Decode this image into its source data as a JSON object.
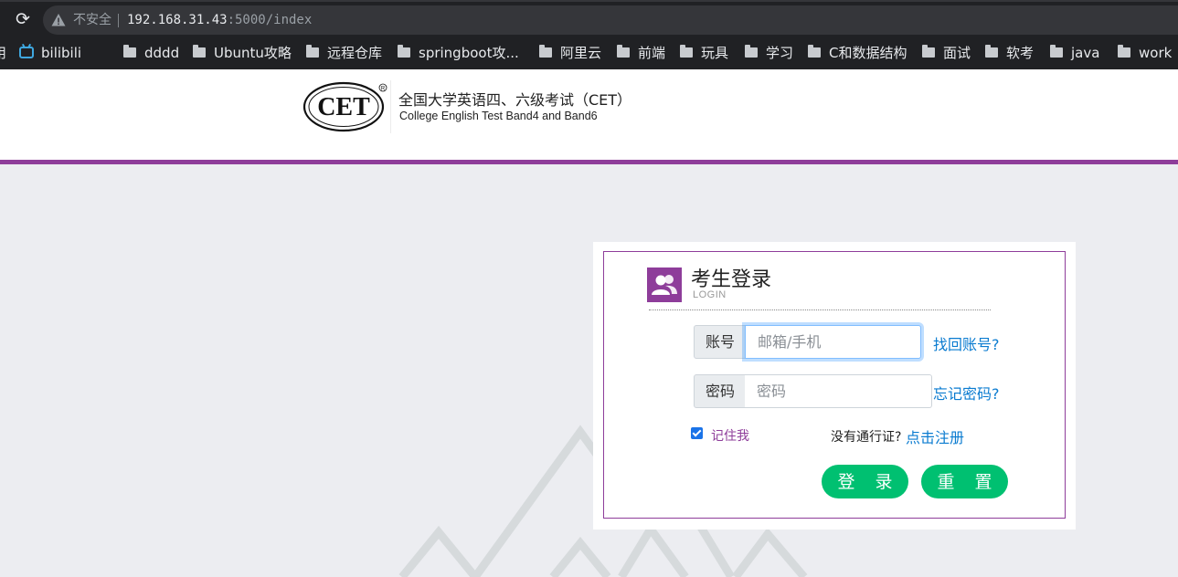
{
  "browser": {
    "security_label": "不安全",
    "url_host": "192.168.31.43",
    "url_rest": ":5000/index",
    "bookmarks": [
      {
        "label": "bilibili",
        "icon": "bilibili-icon"
      },
      {
        "label": "dddd",
        "icon": "folder-icon"
      },
      {
        "label": "Ubuntu攻略",
        "icon": "folder-icon"
      },
      {
        "label": "远程仓库",
        "icon": "folder-icon"
      },
      {
        "label": "springboot攻...",
        "icon": "folder-icon"
      },
      {
        "label": "阿里云",
        "icon": "folder-icon"
      },
      {
        "label": "前端",
        "icon": "folder-icon"
      },
      {
        "label": "玩具",
        "icon": "folder-icon"
      },
      {
        "label": "学习",
        "icon": "folder-icon"
      },
      {
        "label": "C和数据结构",
        "icon": "folder-icon"
      },
      {
        "label": "面试",
        "icon": "folder-icon"
      },
      {
        "label": "软考",
        "icon": "folder-icon"
      },
      {
        "label": "java",
        "icon": "folder-icon"
      },
      {
        "label": "work",
        "icon": "folder-icon"
      }
    ],
    "partial_bookmark": "用"
  },
  "header": {
    "logo_text": "CET",
    "title": "全国大学英语四、六级考试（CET）",
    "subtitle": "College English Test Band4 and Band6"
  },
  "login": {
    "title": "考生登录",
    "subtitle": "LOGIN",
    "account_label": "账号",
    "account_placeholder": "邮箱/手机",
    "find_account": "找回账号?",
    "password_label": "密码",
    "password_placeholder": "密码",
    "forgot_password": "忘记密码?",
    "remember_me": "记住我",
    "remember_checked": true,
    "no_pass_text": "没有通行证?",
    "register_link": "点击注册",
    "login_button": "登 录",
    "reset_button": "重 置"
  },
  "colors": {
    "brand_purple": "#8e3d9a",
    "button_green": "#00c071",
    "link_blue": "#0a7bd0",
    "page_bg": "#ecedf1"
  }
}
